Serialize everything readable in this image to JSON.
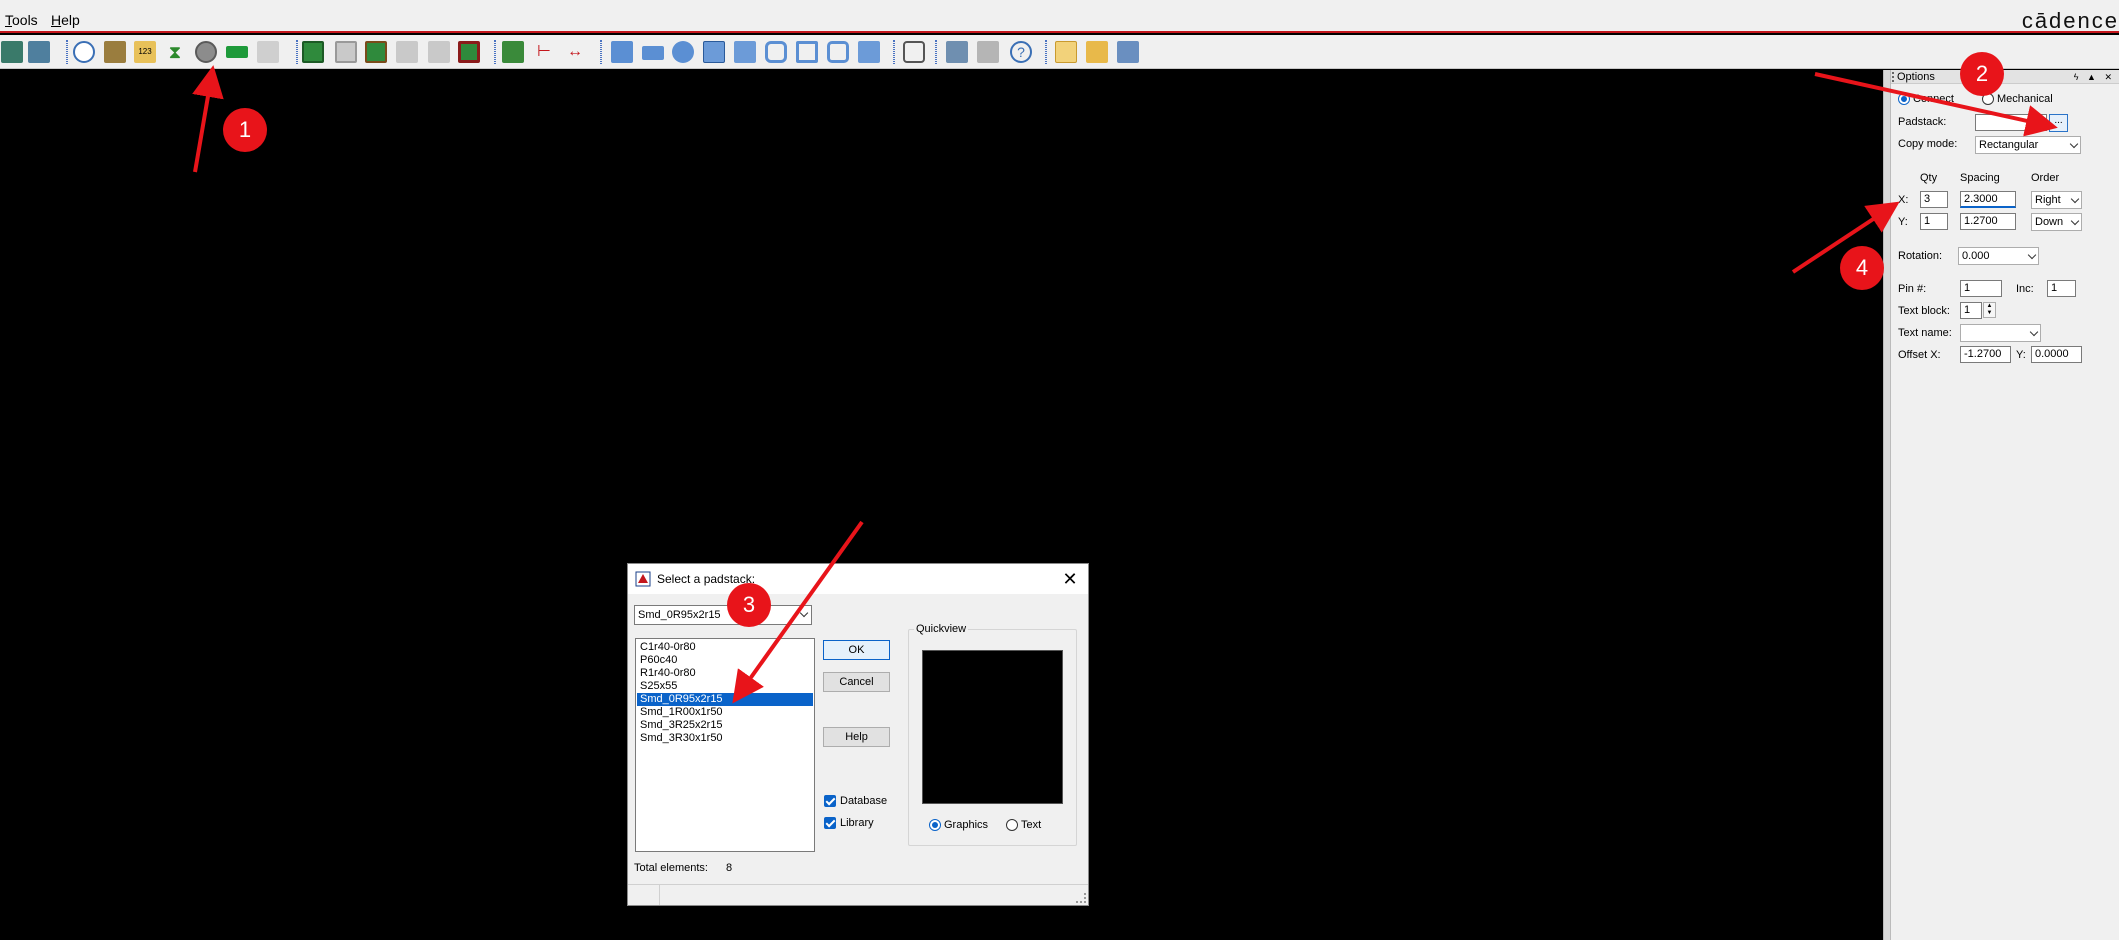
{
  "menu": {
    "items": [
      "Tools",
      "Help"
    ],
    "brand": "cādence"
  },
  "toolbar": {
    "icons": [
      "swap-icon",
      "component-icon",
      "info-icon",
      "properties-icon",
      "number-123-icon",
      "sigma-icon",
      "add-pin-icon",
      "text-block-icon",
      "gray-icon",
      "board-icon",
      "board-gray-icon",
      "board-green-icon",
      "gray-square-icon",
      "gray-square2-icon",
      "board-frame-icon",
      "camera-green-icon",
      "dimension-icon",
      "dimension-horizontal-icon",
      "shape-polygon-icon",
      "shape-rect-icon",
      "shape-circle-icon",
      "select-icon",
      "shape-merge-icon",
      "shape-void-icon",
      "shape-frame-icon",
      "shape-square-icon",
      "shape-circle-frame-icon",
      "screenshot-icon",
      "camera-icon",
      "stack-icon",
      "route-icon",
      "help-icon",
      "new-file-icon",
      "open-file-icon",
      "save-icon"
    ]
  },
  "options": {
    "title": "Options",
    "controls": "ϟ ▲ ✕",
    "radio_connect": "Connect",
    "radio_mechanical": "Mechanical",
    "padstack_label": "Padstack:",
    "padstack_value": "",
    "browse_label": "...",
    "copy_mode_label": "Copy mode:",
    "copy_mode_value": "Rectangular",
    "qty_header": "Qty",
    "spacing_header": "Spacing",
    "order_header": "Order",
    "x_label": "X:",
    "x_qty": "3",
    "x_spacing": "2.3000",
    "x_order": "Right",
    "y_label": "Y:",
    "y_qty": "1",
    "y_spacing": "1.2700",
    "y_order": "Down",
    "rotation_label": "Rotation:",
    "rotation_value": "0.000",
    "pin_label": "Pin #:",
    "pin_value": "1",
    "inc_label": "Inc:",
    "inc_value": "1",
    "text_block_label": "Text block:",
    "text_block_value": "1",
    "text_name_label": "Text name:",
    "text_name_value": "",
    "offset_x_label": "Offset X:",
    "offset_x_value": "-1.2700",
    "offset_y_label": "Y:",
    "offset_y_value": "0.0000"
  },
  "dialog": {
    "title": "Select a padstack:",
    "combo_value": "Smd_0R95x2r15",
    "list_items": [
      "C1r40-0r80",
      "P60c40",
      "R1r40-0r80",
      "S25x55",
      "Smd_0R95x2r15",
      "Smd_1R00x1r50",
      "Smd_3R25x2r15",
      "Smd_3R30x1r50"
    ],
    "selected_index": 4,
    "ok_label": "OK",
    "cancel_label": "Cancel",
    "help_label": "Help",
    "database_label": "Database",
    "library_label": "Library",
    "quickview_label": "Quickview",
    "graphics_label": "Graphics",
    "text_label": "Text",
    "total_label": "Total elements:",
    "total_value": "8"
  },
  "annotations": {
    "badges": [
      "1",
      "2",
      "3",
      "4"
    ],
    "color": "#e8141a"
  },
  "colors": {
    "accent": "#0a63c9",
    "brand_red": "#c4161c",
    "canvas": "#000000"
  }
}
